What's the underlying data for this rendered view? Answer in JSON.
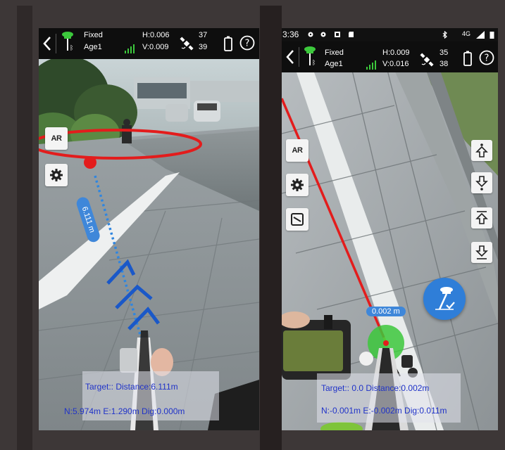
{
  "left_screen": {
    "fix_status": "Fixed",
    "age": "Age1",
    "h_precision": "H:0.006",
    "v_precision": "V:0.009",
    "sats_used": "37",
    "sats_visible": "39",
    "ar_label": "AR",
    "distance_tag": "6.111 m",
    "target_line": "Target::  Distance:6.111m",
    "coord_line": "N:5.974m E:1.290m Dig:0.000m"
  },
  "right_screen": {
    "status_time": "3:36",
    "network": "4G",
    "fix_status": "Fixed",
    "age": "Age1",
    "h_precision": "H:0.009",
    "v_precision": "V:0.016",
    "sats_used": "35",
    "sats_visible": "38",
    "ar_label": "AR",
    "distance_tag": "0.002 m",
    "target_line": "Target::  0.0 Distance:0.002m",
    "coord_line": "N:-0.001m E:-0.002m Dig:0.011m"
  },
  "colors": {
    "accent_blue": "#2f86e0",
    "stake_red": "#e31c1c",
    "fix_green": "#3cc83c",
    "panel_text": "#2033c8"
  }
}
